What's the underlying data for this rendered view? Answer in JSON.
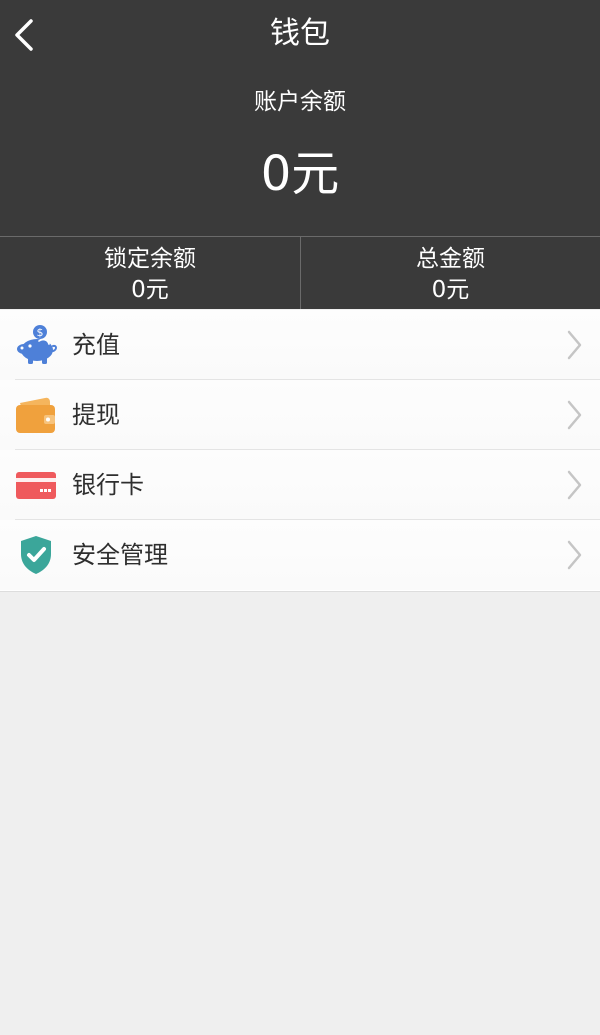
{
  "header": {
    "title": "钱包",
    "balance_label": "账户余额",
    "balance_value": "0元",
    "background_color": "#3a3a3a"
  },
  "summary": {
    "locked": {
      "label": "锁定余额",
      "value": "0元"
    },
    "total": {
      "label": "总金额",
      "value": "0元"
    }
  },
  "menu": {
    "items": [
      {
        "label": "充值",
        "icon": "piggy-bank-icon",
        "icon_color": "#4e80d8"
      },
      {
        "label": "提现",
        "icon": "wallet-icon",
        "icon_color": "#f0a13d"
      },
      {
        "label": "银行卡",
        "icon": "bank-card-icon",
        "icon_color": "#ef5a5d"
      },
      {
        "label": "安全管理",
        "icon": "shield-check-icon",
        "icon_color": "#3ba69a"
      }
    ]
  }
}
